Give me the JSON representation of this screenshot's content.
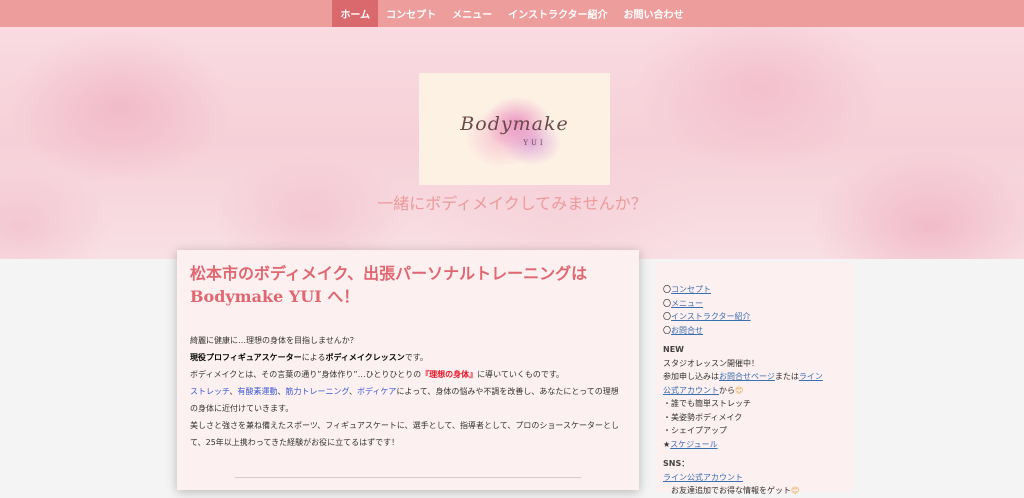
{
  "nav": {
    "items": [
      {
        "label": "ホーム",
        "active": true
      },
      {
        "label": "コンセプト"
      },
      {
        "label": "メニュー"
      },
      {
        "label": "インストラクター紹介"
      },
      {
        "label": "お問い合わせ"
      }
    ]
  },
  "hero": {
    "logo_text": "Bodymake",
    "logo_sub": "YUI",
    "tagline": "一緒にボディメイクしてみませんか？"
  },
  "main": {
    "title": "松本市のボディメイク、出張パーソナルトレーニングは Bodymake YUI へ！",
    "p1": "綺麗に健康に…理想の身体を目指しませんか？",
    "p2_bold1": "現役プロフィギュアスケーター",
    "p2_mid": "による",
    "p2_bold2": "ボディメイクレッスン",
    "p2_end": "です。",
    "p3_start": "ボディメイクとは、その言葉の通り”身体作り”…ひとりひとりの",
    "p3_red": "『理想の身体』",
    "p3_end": "に導いていくものです。",
    "p4_blue1": "ストレッチ",
    "p4_sep1": "、",
    "p4_blue2": "有酸素運動",
    "p4_sep2": "、",
    "p4_blue3": "筋力トレーニング",
    "p4_sep3": "、",
    "p4_blue4": "ボディケア",
    "p4_end": "によって、身体の悩みや不調を改善し、あなたにとっての理想の身体に近付けていきます。",
    "p5": "美しさと強さを兼ね備えたスポーツ、フィギュアスケートに、選手として、指導者として、プロのショースケーターとして、25年以上携わってきた経験がお役に立てるはずです！"
  },
  "sidebar": {
    "links": [
      {
        "bullet": "〇",
        "label": "コンセプト"
      },
      {
        "bullet": "〇",
        "label": "メニュー"
      },
      {
        "bullet": "〇",
        "label": "インストラクター紹介"
      },
      {
        "bullet": "〇",
        "label": "お問合せ"
      }
    ],
    "new_heading": "NEW",
    "new_line1": "スタジオレッスン開催中！",
    "new_line2_start": "参加申し込みは",
    "new_line2_link1": "お問合せページ",
    "new_line2_mid": "または",
    "new_line2_link2a": "ライン",
    "new_line3_link2b": "公式アカウント",
    "new_line3_end": "から",
    "smile_emoji": "😊",
    "bullets": [
      "・誰でも簡単ストレッチ",
      "・美姿勢ボディメイク",
      "・シェイプアップ"
    ],
    "schedule_star": "★",
    "schedule_link": "スケジュール",
    "sns_heading": "SNS：",
    "sns_link": "ライン公式アカウント",
    "sns_line": "　お友達追加でお得な情報をゲット"
  }
}
